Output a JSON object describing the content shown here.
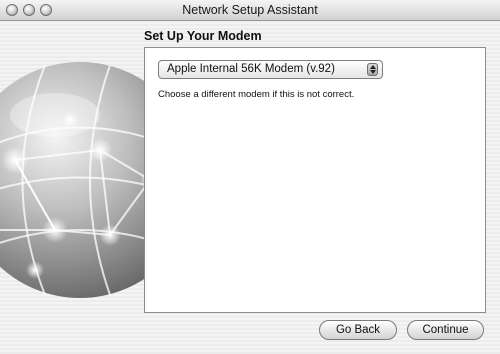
{
  "window": {
    "title": "Network Setup Assistant"
  },
  "titlebar": {
    "buttons": [
      "close-icon",
      "minimize-icon",
      "zoom-icon"
    ]
  },
  "main": {
    "heading": "Set Up Your Modem",
    "modem_select": {
      "value": "Apple Internal 56K Modem (v.92)"
    },
    "hint": "Choose a different modem if this is not correct."
  },
  "footer": {
    "back_label": "Go Back",
    "continue_label": "Continue"
  },
  "icons": {
    "globe": "network-globe-icon",
    "popup_arrows": "up-down-arrows-icon"
  }
}
